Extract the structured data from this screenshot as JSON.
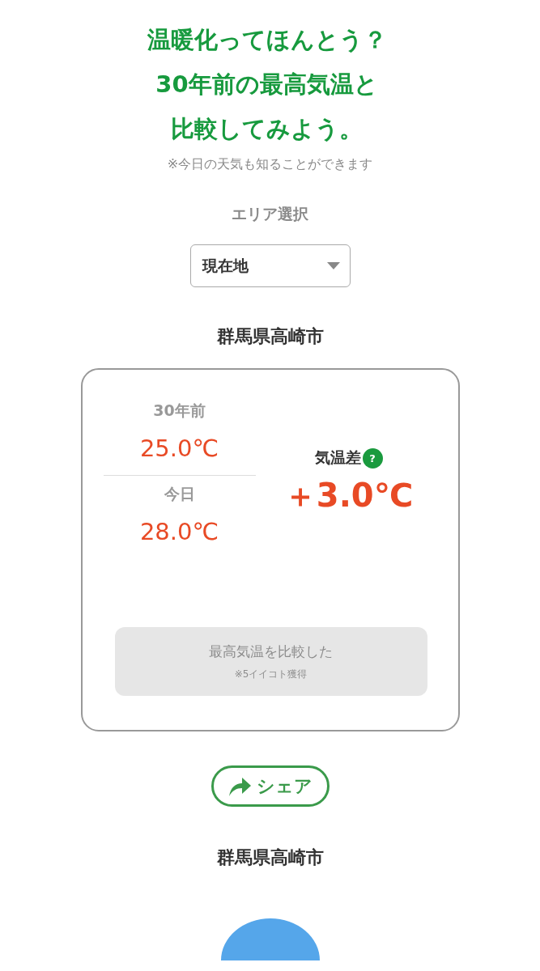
{
  "title": [
    "温暖化ってほんとう？",
    "30年前の最高気温と",
    "比較してみよう。"
  ],
  "subtitle": "※今日の天気も知ることができます",
  "area_label": "エリア選択",
  "area_select": {
    "value": "現在地"
  },
  "location": "群馬県高崎市",
  "comparison": {
    "past_label": "30年前",
    "past_value": "25.0℃",
    "today_label": "今日",
    "today_value": "28.0℃",
    "diff_label": "気温差",
    "help_icon": "?",
    "diff_value": "＋3.0℃",
    "compare_button": {
      "label": "最高気温を比較した",
      "note": "※5イイコト獲得",
      "disabled": true
    }
  },
  "share_button": "シェア",
  "location_2": "群馬県高崎市"
}
